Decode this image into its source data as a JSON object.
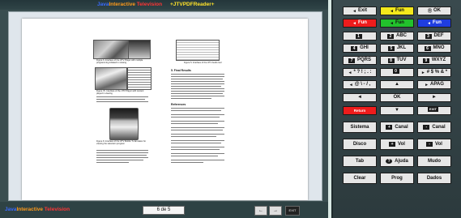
{
  "header": {
    "brand_java": "Java",
    "brand_inter": "Interactive",
    "brand_tv": " Television",
    "reader_title": "+JTVPDFReader+"
  },
  "document": {
    "fig_caption_1": "Figure 6. Interface of the JITV Player with multiple programming initiated tv viewing",
    "fig_caption_2": "Figure 5. Interface of the JITV Audio tool",
    "fig_caption_3": "Figure 7b. Interface of the JITV Player with content played in viewing",
    "fig_caption_4": "Figure 8. Interface of the JITV Mobile Tv Emulator for viewing the television program",
    "results_title": "5. Final Results",
    "references_title": "References"
  },
  "footer": {
    "brand_java": "Java",
    "brand_inter": "Interactive",
    "brand_tv": " Television",
    "page": "6 de 5",
    "prev_icon": "←",
    "next_icon": "→",
    "exit_label": "EXIT"
  },
  "remote": {
    "row1": [
      {
        "label": "Exit",
        "icon": "◄"
      },
      {
        "label": "Fun",
        "icon": "◄"
      },
      {
        "label": "OK",
        "icon": "Ⓡ"
      }
    ],
    "row2": [
      {
        "label": "Fun",
        "icon": "◄"
      },
      {
        "label": "Fun",
        "icon": "◄"
      },
      {
        "label": "Fun",
        "icon": "◄"
      }
    ],
    "row3": [
      {
        "num": "1",
        "label": ""
      },
      {
        "num": "2",
        "label": "ABC"
      },
      {
        "num": "3",
        "label": "DEF"
      }
    ],
    "row4": [
      {
        "num": "4",
        "label": "GHI"
      },
      {
        "num": "5",
        "label": "JKL"
      },
      {
        "num": "6",
        "label": "MNO"
      }
    ],
    "row5": [
      {
        "num": "7",
        "label": "PQRS"
      },
      {
        "num": "8",
        "label": "TUV"
      },
      {
        "num": "9",
        "label": "WXYZ"
      }
    ],
    "row6": [
      {
        "num": "◄",
        "label": "* ? ! ; . :"
      },
      {
        "num": "0",
        "label": ""
      },
      {
        "num": "►",
        "label": "# $ % & *"
      }
    ],
    "row7": [
      {
        "icon": "◄",
        "label": "@ \\ - / ,"
      },
      {
        "icon": "▲",
        "label": ""
      },
      {
        "icon": "►",
        "label": "APAG"
      }
    ],
    "row8": [
      {
        "icon": "◄",
        "label": ""
      },
      {
        "icon": "",
        "label": "OK"
      },
      {
        "icon": "►",
        "label": ""
      }
    ],
    "row9": [
      {
        "label": "Return"
      },
      {
        "icon": "▼",
        "label": ""
      },
      {
        "label": "EXIT"
      }
    ],
    "row10": [
      {
        "label": "Sistema"
      },
      {
        "icon": "+",
        "label": "Canal"
      },
      {
        "icon": "-",
        "label": "Canal"
      }
    ],
    "row11": [
      {
        "label": "Disco"
      },
      {
        "icon": "+",
        "label": "Vol"
      },
      {
        "icon": "-",
        "label": "Vol"
      }
    ],
    "row12": [
      {
        "label": "Tab"
      },
      {
        "icon": "?",
        "label": "Ajuda"
      },
      {
        "label": "Mudo"
      }
    ],
    "row13": [
      {
        "label": "Clear"
      },
      {
        "label": "Prog"
      },
      {
        "label": "Dados"
      }
    ]
  },
  "colors": {
    "yellow": "#f4e81c",
    "red": "#ee1c1c",
    "green": "#22c12c",
    "blue": "#1f3de0"
  }
}
